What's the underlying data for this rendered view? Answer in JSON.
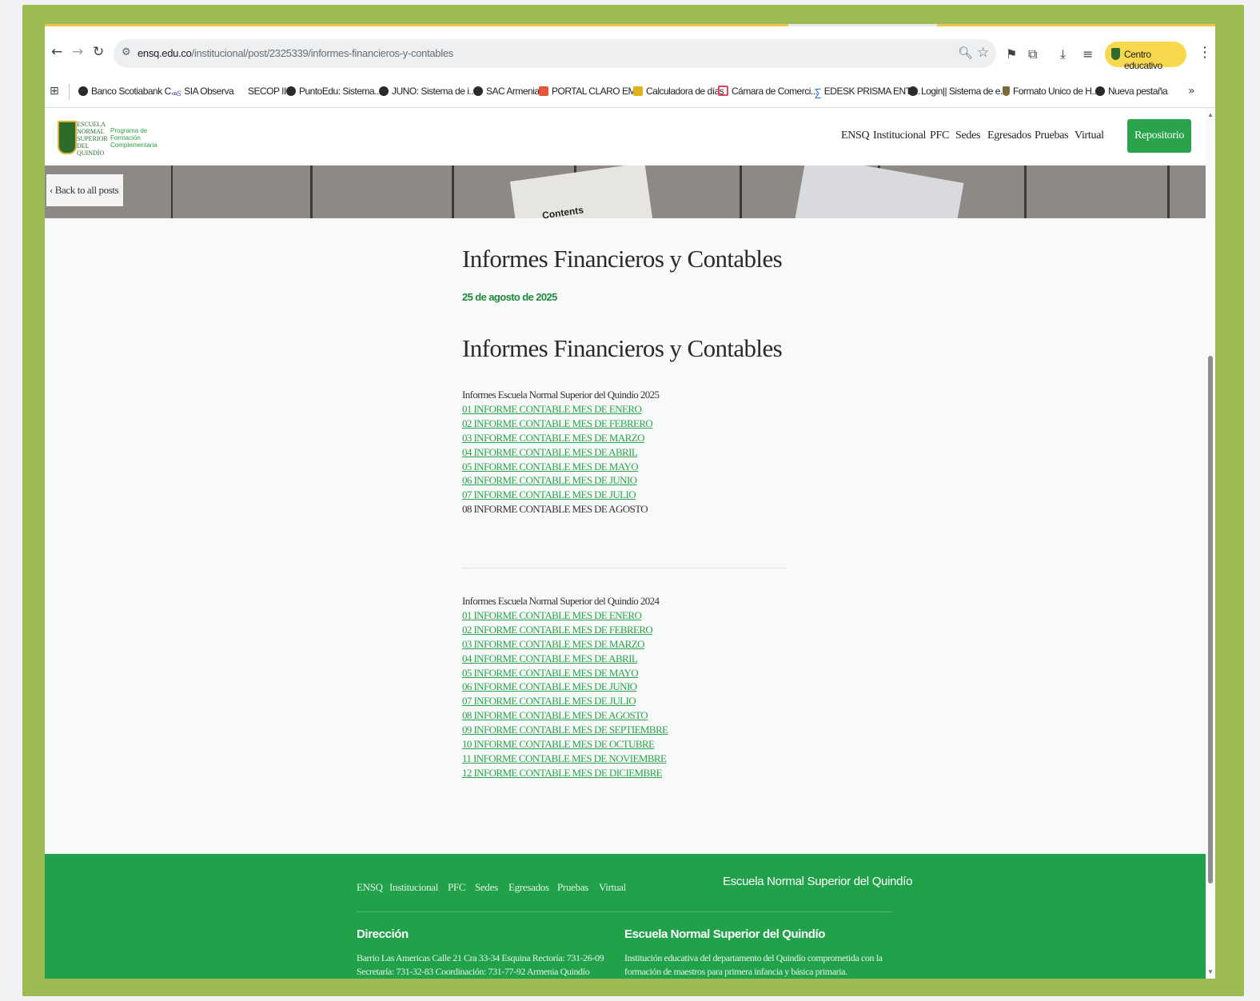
{
  "browser": {
    "url_host": "ensq.edu.co",
    "url_path": "/institucional/post/2325339/informes-financieros-y-contables",
    "profile_chip": "Centro educativo",
    "bookmarks": [
      "Banco Scotiabank C...",
      "SIA Observa",
      "SECOP II",
      "PuntoEdu: Sistema...",
      "JUNO: Sistema de i...",
      "SAC Armenia",
      "PORTAL CLARO EM...",
      "Calculadora de días",
      "Cámara de Comerci...",
      "EDESK PRISMA ENTI...",
      "Login|| Sistema de e...",
      "Formato Unico de H...",
      "Nueva pestaña"
    ],
    "icons": [
      "back-arrow-icon",
      "forward-arrow-icon",
      "reload-icon",
      "tune-icon",
      "zoom-icon",
      "star-icon",
      "flag-icon",
      "extension-icon",
      "download-icon",
      "media-queue-icon",
      "kebab-menu-icon"
    ]
  },
  "site": {
    "logo_text": "ESCUELA NORMAL SUPERIOR DEL QUINDÍO",
    "logo_sub": "Programa de Formación Complementaria",
    "nav": [
      "ENSQ",
      "Institucional",
      "PFC",
      "Sedes",
      "Egresados",
      "Pruebas",
      "Virtual"
    ],
    "repo_button": "Repositorio",
    "back_link": "‹ Back to all posts",
    "banner_text": "Contents"
  },
  "post": {
    "title": "Informes Financieros y Contables",
    "date": "25 de agosto de 2025",
    "body_title": "Informes Financieros y Contables",
    "section_2025": {
      "heading": "Informes Escuela Normal Superior del Quindío 2025",
      "links": [
        "01 INFORME CONTABLE MES DE ENERO",
        "02 INFORME CONTABLE MES DE FEBRERO",
        "03 INFORME CONTABLE MES DE MARZO",
        "04 INFORME CONTABLE MES DE ABRIL",
        "05 INFORME CONTABLE MES DE MAYO",
        "06 INFORME CONTABLE MES DE JUNIO",
        "07 INFORME CONTABLE MES DE JULIO"
      ],
      "plain": "08 INFORME CONTABLE MES DE AGOSTO"
    },
    "section_2024": {
      "heading": "Informes Escuela Normal Superior del Quindío 2024",
      "links": [
        "01 INFORME CONTABLE MES DE ENERO",
        "02 INFORME CONTABLE MES DE FEBRERO",
        "03 INFORME CONTABLE MES DE MARZO",
        "04 INFORME CONTABLE MES DE ABRIL",
        "05 INFORME CONTABLE MES DE MAYO",
        "06 INFORME CONTABLE MES DE JUNIO",
        "07 INFORME CONTABLE MES DE JULIO",
        "08 INFORME CONTABLE MES DE AGOSTO",
        "09 INFORME CONTABLE MES DE SEPTIEMBRE",
        "10 INFORME CONTABLE MES DE OCTUBRE",
        "11 INFORME CONTABLE MES DE NOVIEMBRE",
        "12 INFORME CONTABLE MES DE DICIEMBRE"
      ]
    }
  },
  "footer": {
    "nav": [
      "ENSQ",
      "Institucional",
      "PFC",
      "Sedes",
      "Egresados",
      "Pruebas",
      "Virtual"
    ],
    "brand": "Escuela Normal Superior del Quindío",
    "address_heading": "Dirección",
    "address_line1": "Barrio Las Americas Calle 21 Cra 33-34 Esquina Rectoría: 731-26-09",
    "address_line2": "Secretaría: 731-32-83 Coordinación: 731-77-92 Armenia Quindío",
    "about_heading": "Escuela Normal Superior del Quindío",
    "about_line1": "Institución educativa del departamento del Quindío comprometida con la",
    "about_line2": "formación de maestros para primera infancia y básica primaria."
  },
  "colors": {
    "frame": "#9cbb55",
    "brand_green": "#2aa44b",
    "footer_green": "#21a24a",
    "chip_yellow": "#f7d84f"
  }
}
